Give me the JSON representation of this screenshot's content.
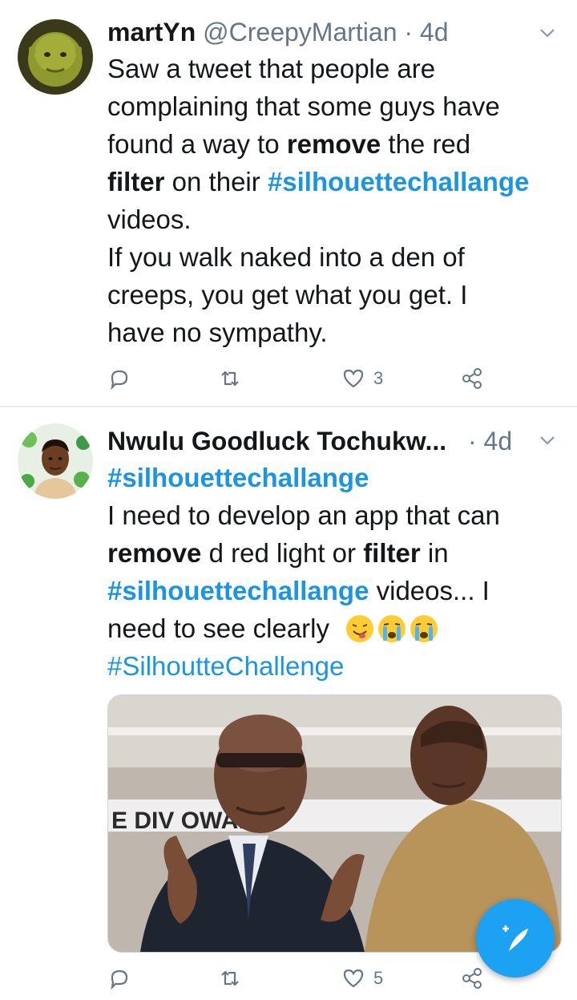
{
  "tweets": [
    {
      "name": "martYn",
      "handle": "@CreepyMartian",
      "sep": "·",
      "time": "4d",
      "lines": [
        "Saw a tweet that people are",
        "complaining that some guys have",
        [
          "found a way to ",
          "remove",
          " the red"
        ],
        [
          "filter",
          " on their ",
          "#silhouettechallange"
        ],
        "videos.",
        "If you walk naked into a den of",
        "creeps, you get what you get. I",
        "have no sympathy."
      ],
      "reply_count": "",
      "retweet_count": "",
      "like_count": "3"
    },
    {
      "name": "Nwulu Goodluck Tochukw...",
      "sep": "·",
      "time": "4d",
      "lines": [
        "#silhouettechallange",
        "I need to develop an app that can",
        [
          "remove",
          " d red light or ",
          "filter",
          " in"
        ],
        [
          "#silhouettechallange",
          "  videos... I"
        ],
        "need to see clearly",
        "#SilhoutteChallenge"
      ],
      "media_text": "E DIV   OWAR",
      "reply_count": "",
      "retweet_count": "",
      "like_count": "5"
    }
  ],
  "icons": {
    "reply": "reply-icon",
    "retweet": "retweet-icon",
    "like": "heart-icon",
    "share": "share-icon",
    "more": "chevron-down-icon",
    "compose": "compose-tweet-icon"
  },
  "colors": {
    "accent": "#1da1f2",
    "hashtag": "#1b95e0",
    "secondary": "#657786",
    "divider": "#e6ecf0"
  }
}
